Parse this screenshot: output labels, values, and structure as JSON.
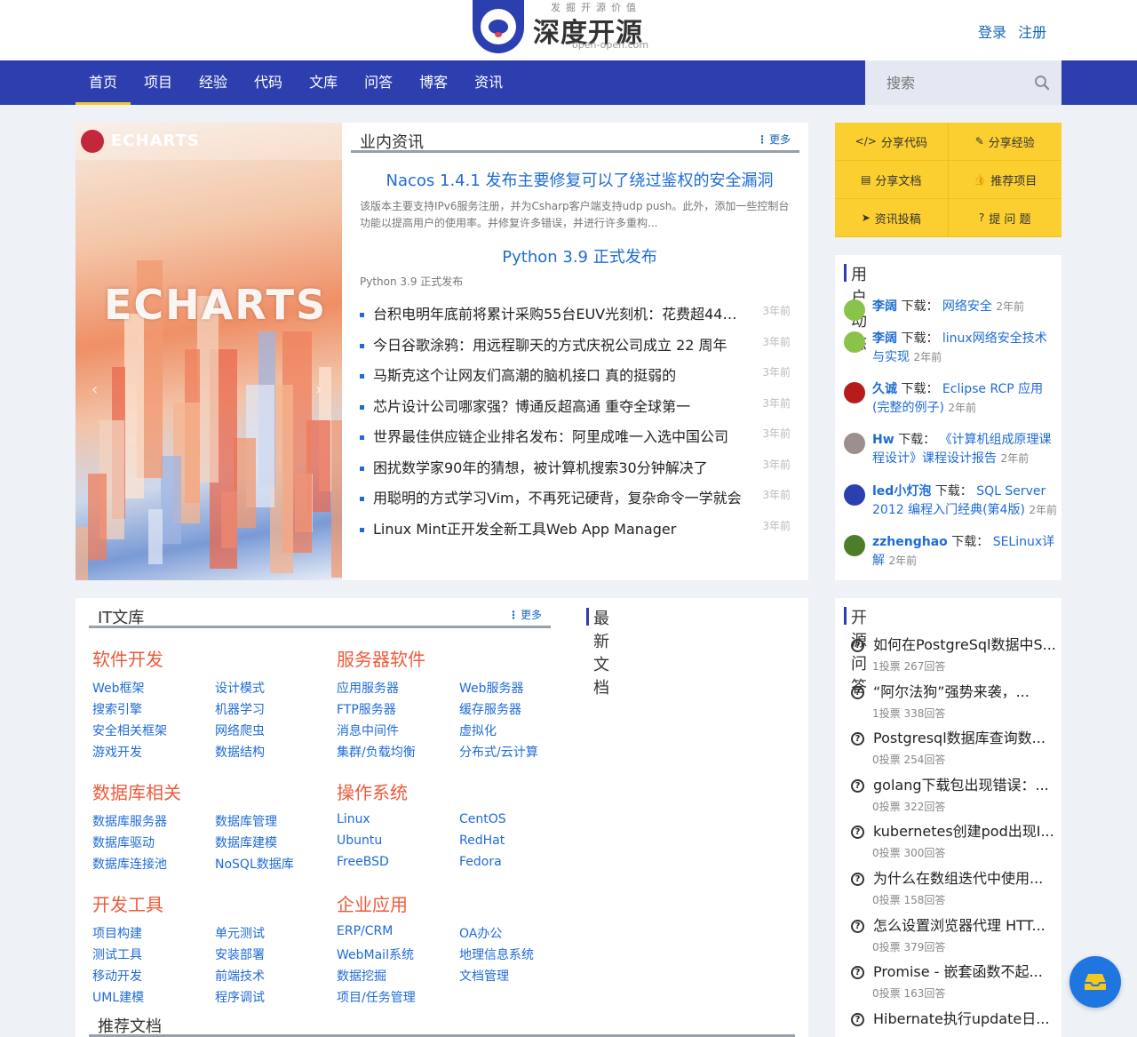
{
  "header": {
    "logo": {
      "slogan": "发掘开源价值",
      "name": "深度开源",
      "domain": "open-open.com"
    },
    "login": "登录",
    "register": "注册"
  },
  "nav": {
    "items": [
      "首页",
      "项目",
      "经验",
      "代码",
      "文库",
      "问答",
      "博客",
      "资讯"
    ],
    "active": "首页",
    "search": {
      "placeholder": "搜索",
      "value": ""
    }
  },
  "banner": {
    "logo_text": "ECHARTS",
    "title": "ECHARTS"
  },
  "news": {
    "title": "业内资讯",
    "more": "更多",
    "featured": [
      {
        "title": "Nacos 1.4.1 发布主要修复可以了绕过鉴权的安全漏洞",
        "desc": "该版本主要支持IPv6服务注册，并为Csharp客户端支持udp push。此外，添加一些控制台功能以提高用户的使用率。并修复许多错误，并进行许多重构..."
      },
      {
        "title": "Python 3.9 正式发布",
        "desc": "Python 3.9 正式发布"
      }
    ],
    "items": [
      {
        "title": "台积电明年底前将累计采购55台EUV光刻机：花费超44亿美元",
        "time": "3年前"
      },
      {
        "title": "今日谷歌涂鸦：用远程聊天的方式庆祝公司成立 22 周年",
        "time": "3年前"
      },
      {
        "title": "马斯克这个让网友们高潮的脑机接口 真的挺弱的",
        "time": "3年前"
      },
      {
        "title": "芯片设计公司哪家强？博通反超高通 重夺全球第一",
        "time": "3年前"
      },
      {
        "title": "世界最佳供应链企业排名发布：阿里成唯一入选中国公司",
        "time": "3年前"
      },
      {
        "title": "困扰数学家90年的猜想，被计算机搜索30分钟解决了",
        "time": "3年前"
      },
      {
        "title": "用聪明的方式学习Vim，不再死记硬背，复杂命令一学就会",
        "time": "3年前"
      },
      {
        "title": "Linux Mint正开发全新工具Web App Manager",
        "time": "3年前"
      }
    ]
  },
  "share": [
    {
      "icon": "code-icon",
      "glyph": "</>",
      "label": "分享代码"
    },
    {
      "icon": "pen-icon",
      "glyph": "✎",
      "label": "分享经验"
    },
    {
      "icon": "document-icon",
      "glyph": "▤",
      "label": "分享文档"
    },
    {
      "icon": "thumbs-up-icon",
      "glyph": "👍",
      "label": "推荐项目"
    },
    {
      "icon": "paper-plane-icon",
      "glyph": "➤",
      "label": "资讯投稿"
    },
    {
      "icon": "question-icon",
      "glyph": "?",
      "label": "提 问 题"
    }
  ],
  "user_activity": {
    "title": "用户动态",
    "items": [
      {
        "user": "李阔",
        "action": "下载：",
        "resource": "网络安全",
        "time": "2年前",
        "avatar_color": "#8bc34a"
      },
      {
        "user": "李阔",
        "action": "下载：",
        "resource": "linux网络安全技术与实现",
        "time": "2年前",
        "avatar_color": "#8bc34a"
      },
      {
        "user": "久诚",
        "action": "下载：",
        "resource": "Eclipse RCP 应用(完整的例子)",
        "time": "2年前",
        "avatar_color": "#b71c1c"
      },
      {
        "user": "Hw",
        "action": "下载：",
        "resource": "《计算机组成原理课程设计》课程设计报告",
        "time": "2年前",
        "avatar_color": "#9e8f8f"
      },
      {
        "user": "led小灯泡",
        "action": "下载：",
        "resource": "SQL Server 2012 编程入门经典(第4版)",
        "time": "2年前",
        "avatar_color": "#2c3fb1"
      },
      {
        "user": "zzhenghao",
        "action": "下载：",
        "resource": "SELinux详解",
        "time": "2年前",
        "avatar_color": "#4e7d2a"
      }
    ]
  },
  "library": {
    "title": "IT文库",
    "more": "更多",
    "latest_title": "最新文档",
    "recommended_title": "推荐文档",
    "categories": [
      {
        "title": "软件开发",
        "links": [
          "Web框架",
          "设计模式",
          "搜索引擎",
          "机器学习",
          "安全相关框架",
          "网络爬虫",
          "游戏开发",
          "数据结构"
        ]
      },
      {
        "title": "服务器软件",
        "links": [
          "应用服务器",
          "Web服务器",
          "FTP服务器",
          "缓存服务器",
          "消息中间件",
          "虚拟化",
          "集群/负载均衡",
          "分布式/云计算"
        ]
      },
      {
        "title": "数据库相关",
        "links": [
          "数据库服务器",
          "数据库管理",
          "数据库驱动",
          "数据库建模",
          "数据库连接池",
          "NoSQL数据库"
        ]
      },
      {
        "title": "操作系统",
        "links": [
          "Linux",
          "CentOS",
          "Ubuntu",
          "RedHat",
          "FreeBSD",
          "Fedora"
        ]
      },
      {
        "title": "开发工具",
        "links": [
          "项目构建",
          "单元测试",
          "测试工具",
          "安装部署",
          "移动开发",
          "前端技术",
          "UML建模",
          "程序调试"
        ]
      },
      {
        "title": "企业应用",
        "links": [
          "ERP/CRM",
          "OA办公",
          "WebMail系统",
          "地理信息系统",
          "数据挖掘",
          "文档管理",
          "项目/任务管理"
        ]
      }
    ]
  },
  "qa": {
    "title": "开源问答",
    "items": [
      {
        "question": "如何在PostgreSql数据中S...",
        "meta": "1投票 267回答"
      },
      {
        "question": "“阿尔法狗”强势来袭，...",
        "meta": "1投票 338回答"
      },
      {
        "question": "Postgresql数据库查询数...",
        "meta": "0投票 254回答"
      },
      {
        "question": "golang下载包出现错误：...",
        "meta": "0投票 322回答"
      },
      {
        "question": "kubernetes创建pod出现I...",
        "meta": "0投票 300回答"
      },
      {
        "question": "为什么在数组迭代中使用...",
        "meta": "0投票 158回答"
      },
      {
        "question": "怎么设置浏览器代理 HTT...",
        "meta": "0投票 379回答"
      },
      {
        "question": "Promise - 嵌套函数不起...",
        "meta": "0投票 163回答"
      },
      {
        "question": "Hibernate执行update日...",
        "meta": ""
      }
    ]
  }
}
